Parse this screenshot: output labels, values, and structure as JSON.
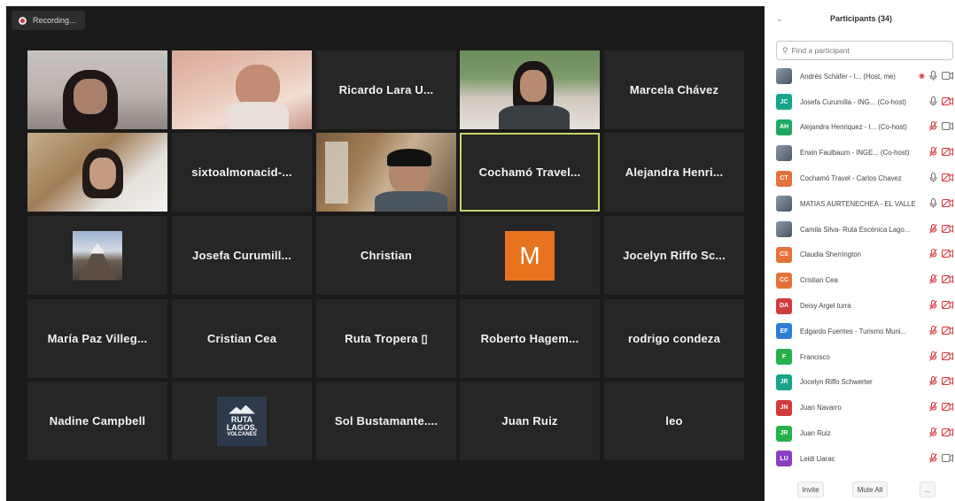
{
  "recording": {
    "label": "Recording..."
  },
  "tiles": [
    {
      "id": "t0",
      "name": "",
      "video": true
    },
    {
      "id": "t1",
      "name": "",
      "video": true
    },
    {
      "id": "t2",
      "name": "Ricardo Lara U..."
    },
    {
      "id": "t3",
      "name": "",
      "video": true
    },
    {
      "id": "t4",
      "name": "Marcela Chávez"
    },
    {
      "id": "t5",
      "name": "",
      "video": true
    },
    {
      "id": "t6",
      "name": "sixtoalmonacid-..."
    },
    {
      "id": "t7",
      "name": "",
      "video": true
    },
    {
      "id": "t8",
      "name": "Cochamó Travel...",
      "active": true
    },
    {
      "id": "t9",
      "name": "Alejandra Henri..."
    },
    {
      "id": "t10",
      "name": "",
      "picture": "mountain"
    },
    {
      "id": "t11",
      "name": "Josefa Curumill..."
    },
    {
      "id": "t12",
      "name": "Christian"
    },
    {
      "id": "t13",
      "name": "",
      "letter": "M"
    },
    {
      "id": "t14",
      "name": "Jocelyn Riffo Sc..."
    },
    {
      "id": "t15",
      "name": "María Paz Villeg..."
    },
    {
      "id": "t16",
      "name": "Cristian Cea"
    },
    {
      "id": "t17",
      "name": "Ruta Tropera ▯"
    },
    {
      "id": "t18",
      "name": "Roberto Hagem..."
    },
    {
      "id": "t19",
      "name": "rodrigo condeza"
    },
    {
      "id": "t20",
      "name": "Nadine Campbell"
    },
    {
      "id": "t21",
      "name": "",
      "logo": [
        "RUTA",
        "LAGOS,",
        "VOLCANES"
      ]
    },
    {
      "id": "t22",
      "name": "Sol Bustamante...."
    },
    {
      "id": "t23",
      "name": "Juan Ruiz"
    },
    {
      "id": "t24",
      "name": "leo"
    }
  ],
  "panel": {
    "title": "Participants (34)",
    "search_placeholder": "Find a participant",
    "participants": [
      {
        "initials": "",
        "avatar_color": "",
        "name": "Andrés Schäfer - I... (Host, me)",
        "mic": "on",
        "cam": "on",
        "recording": true,
        "photo": true
      },
      {
        "initials": "JC",
        "avatar_color": "#17a58a",
        "name": "Josefa Curumilla - ING... (Co-host)",
        "mic": "on",
        "cam": "off"
      },
      {
        "initials": "AH",
        "avatar_color": "#20a860",
        "name": "Alejandra Henriquez - I... (Co-host)",
        "mic": "off",
        "cam": "on"
      },
      {
        "initials": "",
        "avatar_color": "",
        "name": "Erwin Faulbaum - INGE... (Co-host)",
        "mic": "off",
        "cam": "off",
        "photo": true
      },
      {
        "initials": "CT",
        "avatar_color": "#e5713a",
        "name": "Cochamó Travel - Carlos Chavez",
        "mic": "on",
        "cam": "off"
      },
      {
        "initials": "",
        "avatar_color": "",
        "name": "MATIAS AURTENECHEA - EL VALLE",
        "mic": "on",
        "cam": "off",
        "photo": true
      },
      {
        "initials": "",
        "avatar_color": "",
        "name": "Camila Silva- Ruta Escénica Lago...",
        "mic": "off",
        "cam": "off",
        "photo": true
      },
      {
        "initials": "CS",
        "avatar_color": "#e5713a",
        "name": "Claudia Sherrington",
        "mic": "off",
        "cam": "off"
      },
      {
        "initials": "CC",
        "avatar_color": "#e5713a",
        "name": "Cristian Cea",
        "mic": "off",
        "cam": "off"
      },
      {
        "initials": "DA",
        "avatar_color": "#d33b3b",
        "name": "Deisy Argel turra",
        "mic": "off",
        "cam": "off"
      },
      {
        "initials": "EF",
        "avatar_color": "#2a7fd4",
        "name": "Edgardo Fuentes - Turismo Muni...",
        "mic": "off",
        "cam": "off"
      },
      {
        "initials": "F",
        "avatar_color": "#26b14c",
        "name": "Francisco",
        "mic": "off",
        "cam": "off"
      },
      {
        "initials": "JR",
        "avatar_color": "#17a58a",
        "name": "Jocelyn Riffo Schwerter",
        "mic": "off",
        "cam": "off"
      },
      {
        "initials": "JN",
        "avatar_color": "#d33b3b",
        "name": "Juan Navarro",
        "mic": "off",
        "cam": "off"
      },
      {
        "initials": "JR",
        "avatar_color": "#26b14c",
        "name": "Juan Ruiz",
        "mic": "off",
        "cam": "off"
      },
      {
        "initials": "LU",
        "avatar_color": "#8b3fc4",
        "name": "Leidi Uarac",
        "mic": "off",
        "cam": "on"
      }
    ],
    "footer": {
      "invite": "Invite",
      "mute_all": "Mute All",
      "more": "..."
    }
  },
  "icons": {
    "chevron": "chevron-down-icon",
    "search": "search-icon",
    "mic_on": "mic-icon",
    "mic_off": "mic-muted-icon",
    "cam_on": "camera-icon",
    "cam_off": "camera-off-icon"
  },
  "colors": {
    "stage_bg": "#1a1a1a",
    "tile_bg": "#262626",
    "active_border": "#c9d46a",
    "muted_red": "#d9363e",
    "m_avatar": "#e8731e"
  }
}
